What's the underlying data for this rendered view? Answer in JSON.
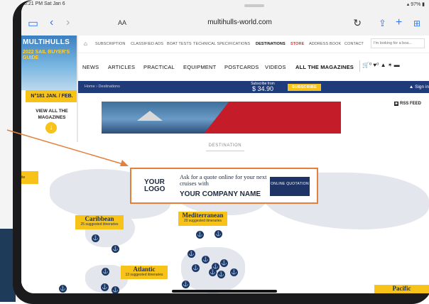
{
  "status_bar": {
    "time": "5:21 PM  Sat Jan 6",
    "right": "▴ 97% ▮"
  },
  "browser": {
    "aa_label": "AA",
    "url": "multihulls-world.com",
    "icons": [
      "sidebar-icon",
      "back-icon",
      "forward-icon",
      "lock-icon",
      "reload-icon",
      "share-icon",
      "new-tab-icon",
      "tabs-icon"
    ]
  },
  "magazine": {
    "title": "MULTIHULLS",
    "cover_text": "2022 SAIL BUYER'S GUIDE",
    "issue": "N°181 JAN. / FEB.",
    "view_all": "VIEW ALL THE MAGAZINES",
    "view_all_icon": "↓"
  },
  "top_nav": {
    "items": [
      "SUBSCRIPTION",
      "CLASSIFIED ADS",
      "BOAT TESTS",
      "TECHNICAL SPECIFICATIONS",
      "DESTINATIONS",
      "STORE",
      "ADDRESS BOOK",
      "CONTACT"
    ],
    "active": "DESTINATIONS",
    "highlight": "STORE",
    "search_placeholder": "I'm looking for a boa..."
  },
  "main_nav": {
    "items": [
      "NEWS",
      "ARTICLES",
      "PRACTICAL",
      "EQUIPMENT",
      "POSTCARDS",
      "VIDEOS",
      "ALL THE MAGAZINES"
    ],
    "bold": "ALL THE MAGAZINES",
    "icons_text": "🛒⁰  ♥⁰   ▲   ✶   ▬"
  },
  "blue_bar": {
    "breadcrumb": "Home › Destinations",
    "subscribe_from": "Subscribe from",
    "price": "$ 34.90",
    "subscribe_button": "SUBSCRIBE",
    "sign_in": "Sign in"
  },
  "rss": {
    "label": "RSS FEED",
    "icon": "◙"
  },
  "section_title": "DESTINATION",
  "left_tab": "ite",
  "quote_box": {
    "logo": "YOUR LOGO",
    "text": "Ask for a quote online for your next cruises with",
    "company": "YOUR COMPANY NAME",
    "button": "ONLINE QUOTATION"
  },
  "regions": [
    {
      "name": "Caribbean",
      "count": "25 suggested itineraries"
    },
    {
      "name": "Mediterranean",
      "count": "20 suggested itineraries"
    },
    {
      "name": "Atlantic",
      "count": "13 suggested itineraries"
    },
    {
      "name": "Pacific",
      "count": ""
    }
  ],
  "pin_icon": "⚓",
  "colors": {
    "accent": "#f7c318",
    "navy": "#1f3b7a",
    "arrow": "#e57f3a"
  }
}
